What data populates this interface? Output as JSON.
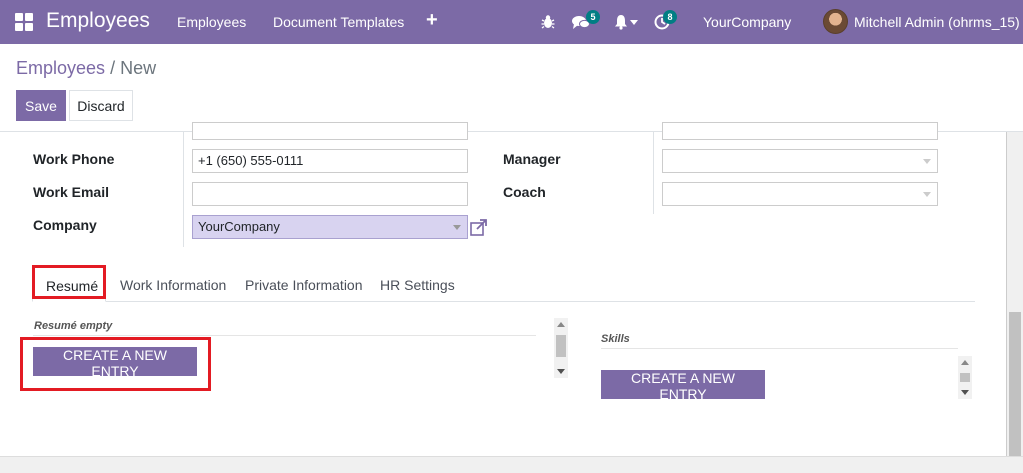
{
  "navbar": {
    "brand": "Employees",
    "menu": [
      "Employees",
      "Document Templates"
    ],
    "messages_badge": "5",
    "activities_badge": "8",
    "company": "YourCompany",
    "user": "Mitchell Admin (ohrms_15)"
  },
  "breadcrumb": {
    "parent": "Employees",
    "separator": "/",
    "current": "New"
  },
  "buttons": {
    "save": "Save",
    "discard": "Discard"
  },
  "form": {
    "work_phone_label": "Work Phone",
    "work_phone_value": "+1 (650) 555-0111",
    "work_email_label": "Work Email",
    "work_email_value": "",
    "company_label": "Company",
    "company_value": "YourCompany",
    "manager_label": "Manager",
    "manager_value": "",
    "coach_label": "Coach",
    "coach_value": ""
  },
  "tabs": [
    "Resumé",
    "Work Information",
    "Private Information",
    "HR Settings"
  ],
  "resume": {
    "empty_label": "Resumé empty",
    "create_label": "CREATE A NEW ENTRY"
  },
  "skills": {
    "title": "Skills",
    "create_label": "CREATE A NEW ENTRY"
  },
  "colors": {
    "brand": "#7c6aa6",
    "highlight": "#e31b23",
    "badge": "#017e84"
  }
}
